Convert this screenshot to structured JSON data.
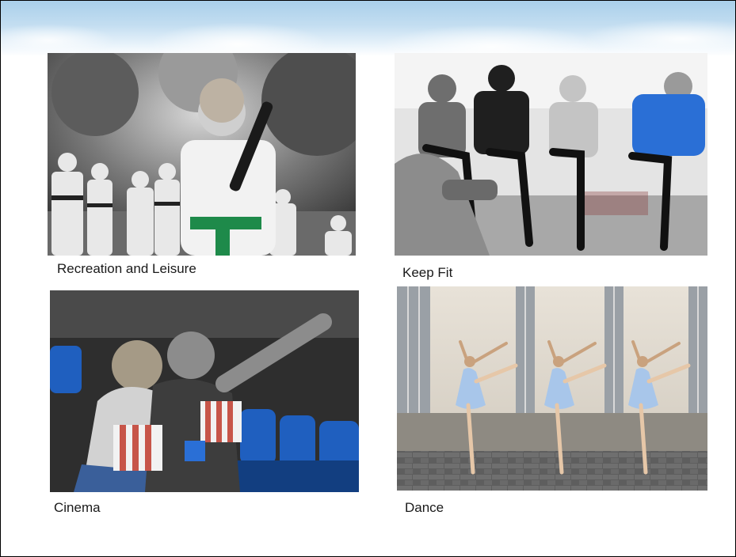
{
  "slide": {
    "photos": [
      {
        "caption": "Recreation and Leisure",
        "icon": "karate-kid-photo"
      },
      {
        "caption": "Keep Fit",
        "icon": "spin-class-photo"
      },
      {
        "caption": "Cinema",
        "icon": "cinema-couple-photo"
      },
      {
        "caption": "Dance",
        "icon": "ballet-dancer-photo"
      }
    ],
    "colors": {
      "sky_top": "#a9cfea",
      "karate_belt": "#1e8a4a",
      "cinema_seats": "#1f5fbf",
      "popcorn_stripe": "#c0392b",
      "shirt_blue": "#2a6fd6",
      "dress_blue": "#a8c6ea"
    }
  }
}
